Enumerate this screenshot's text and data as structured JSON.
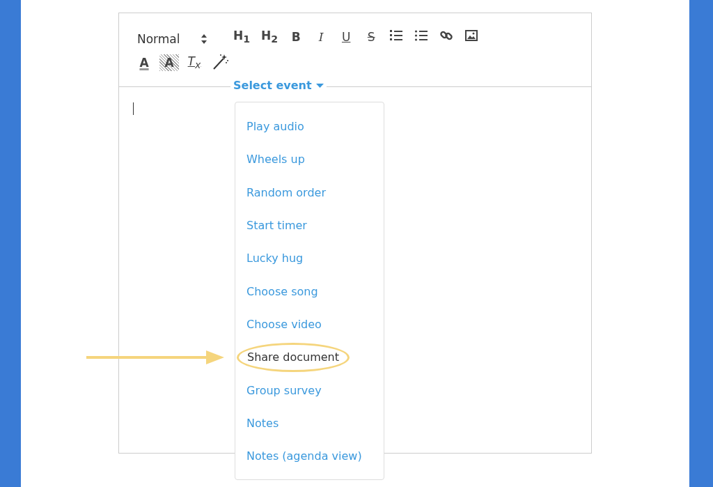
{
  "toolbar": {
    "format_select": "Normal",
    "rows": [
      [
        {
          "kind": "heading",
          "label": "H$_{1}$"
        },
        {
          "kind": "heading",
          "label": "H$_{2}$"
        },
        {
          "kind": "bold",
          "label": "B"
        },
        {
          "kind": "italic",
          "label": "I"
        },
        {
          "kind": "underline",
          "label": "U"
        },
        {
          "kind": "strike",
          "label": "S"
        },
        {
          "kind": "orderedlist"
        },
        {
          "kind": "bulletlist"
        },
        {
          "kind": "link"
        },
        {
          "kind": "image"
        }
      ],
      [
        {
          "kind": "fontcolor",
          "label": "A"
        },
        {
          "kind": "highlight",
          "label": "A"
        },
        {
          "kind": "clearformat",
          "label": "T$_{x}$"
        },
        {
          "kind": "wand"
        }
      ]
    ]
  },
  "event_menu": {
    "label": "Select event",
    "expanded": true,
    "items": [
      {
        "label": "Play audio",
        "selected": false
      },
      {
        "label": "Wheels up",
        "selected": false
      },
      {
        "label": "Random order",
        "selected": false
      },
      {
        "label": "Start timer",
        "selected": false
      },
      {
        "label": "Lucky hug",
        "selected": false
      },
      {
        "label": "Choose song",
        "selected": false
      },
      {
        "label": "Choose video",
        "selected": false
      },
      {
        "label": "Share document",
        "selected": true
      },
      {
        "label": "Group survey",
        "selected": false
      },
      {
        "label": "Notes",
        "selected": false
      },
      {
        "label": "Notes (agenda view)",
        "selected": false
      }
    ]
  }
}
